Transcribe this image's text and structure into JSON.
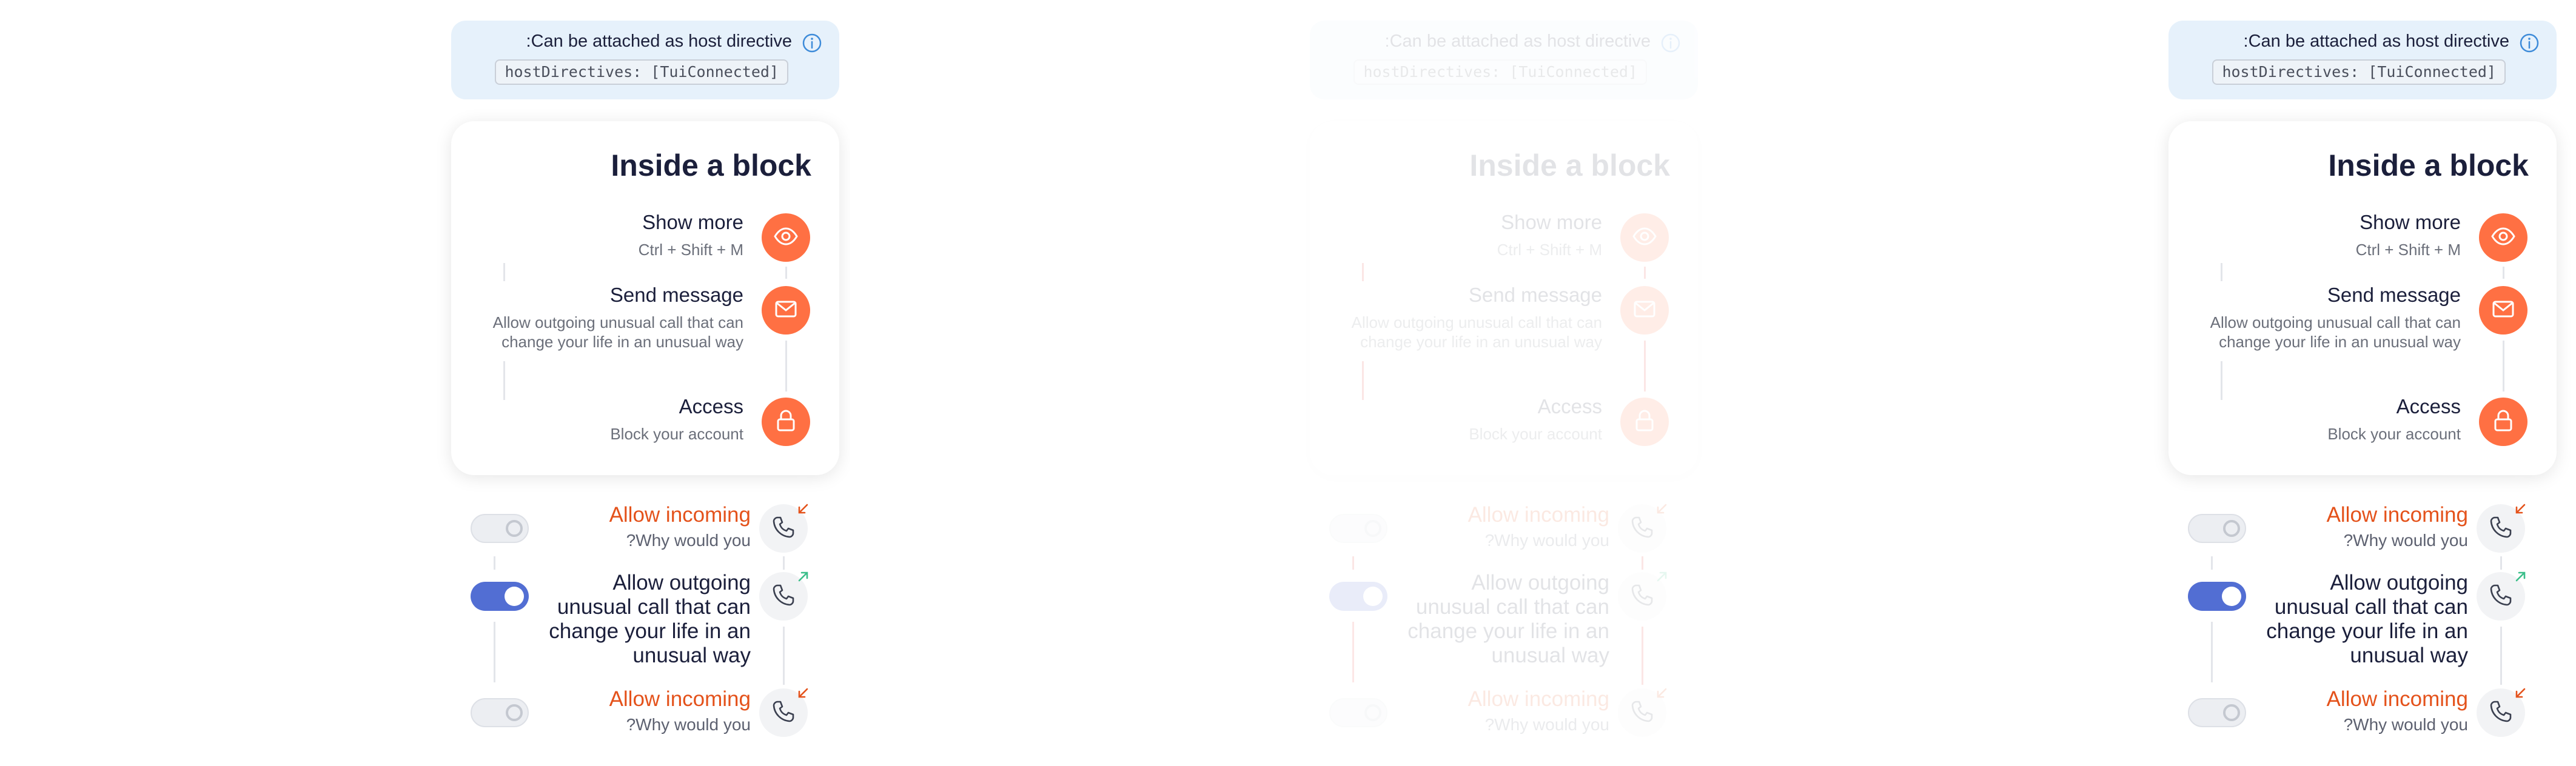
{
  "note": {
    "text": ":Can be attached as host directive",
    "code": "hostDirectives: [TuiConnected]",
    "icon": "info-icon"
  },
  "card": {
    "title": "Inside a block",
    "items": [
      {
        "title": "Show more",
        "description": "Ctrl + Shift + M",
        "icon": "eye-icon"
      },
      {
        "title": "Send message",
        "description": "Allow outgoing unusual call that can change your life in an unusual way",
        "icon": "mail-icon"
      },
      {
        "title": "Access",
        "description": "Block your account",
        "icon": "lock-icon"
      }
    ]
  },
  "calls": [
    {
      "title": "Allow incoming",
      "subtitle": "?Why would you",
      "toggle": "off",
      "direction": "incoming",
      "icon": "phone-icon"
    },
    {
      "title": "Allow outgoing unusual call that can change your life in an unusual way",
      "subtitle": "",
      "toggle": "on",
      "direction": "outgoing",
      "icon": "phone-icon"
    },
    {
      "title": "Allow incoming",
      "subtitle": "?Why would you",
      "toggle": "off",
      "direction": "incoming",
      "icon": "phone-icon"
    }
  ],
  "colors": {
    "accent": "#ff7043",
    "accent_text": "#e4521b",
    "toggle_on": "#526ed3",
    "note_bg": "#e6f1fb",
    "info": "#3d8bd9",
    "incoming_arrow": "#e4521b",
    "outgoing_arrow": "#3bbf8a",
    "debug_line": "#e53935"
  }
}
